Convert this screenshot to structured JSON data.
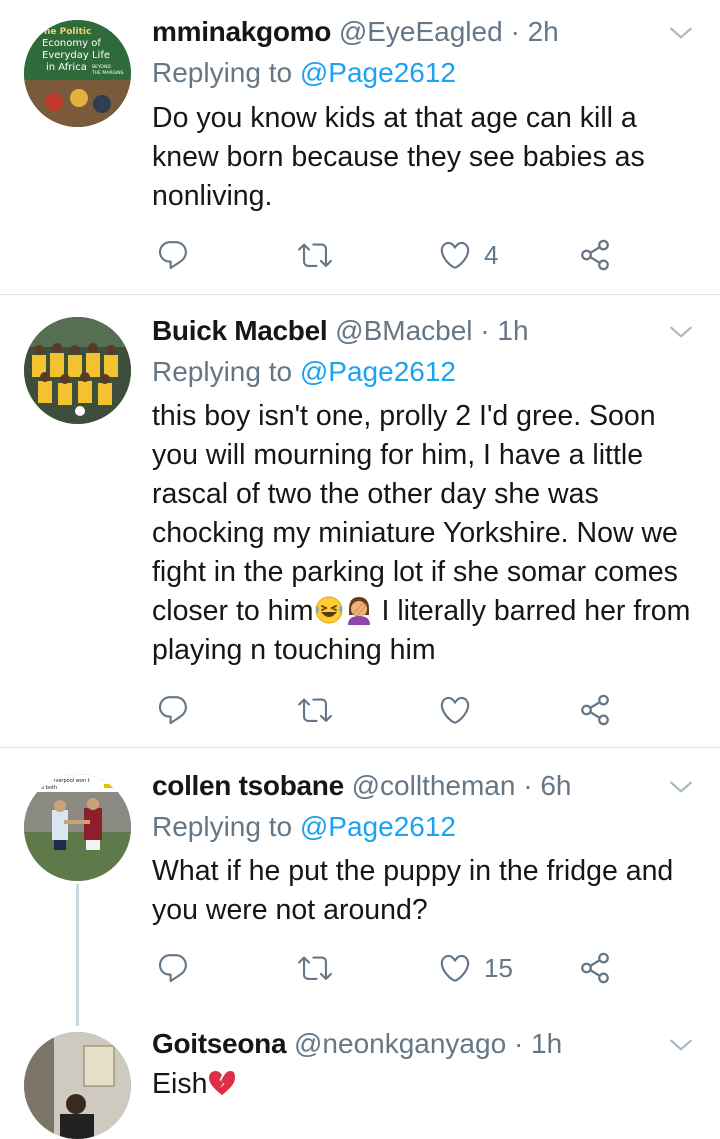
{
  "tweets": [
    {
      "name": "mminakgomo",
      "handle": "@EyeEagled",
      "time": "2h",
      "replying_prefix": "Replying to ",
      "replying_to": "@Page2612",
      "text": "Do you know kids at that age can kill a knew born because they see babies as nonliving.",
      "replies": "",
      "retweets": "",
      "likes": "4",
      "avatar_text": [
        "he Politic",
        "Economy of",
        "Everyday Life",
        "in Africa",
        "BEYOND",
        "THE MARGINS"
      ]
    },
    {
      "name": "Buick Macbel",
      "handle": "@BMacbel",
      "time": "1h",
      "replying_prefix": "Replying to ",
      "replying_to": "@Page2612",
      "text_before_emoji": "this boy isn't one, prolly 2 I'd gree. Soon you will mourning for him, I have a little rascal of two the other day she was chocking my miniature Yorkshire. Now we fight in the parking lot if she somar comes closer to him",
      "text_after_emoji": " I literally barred her from playing n touching him",
      "likes": ""
    },
    {
      "name": "collen tsobane",
      "handle": "@colltheman",
      "time": "6h",
      "replying_prefix": "Replying to ",
      "replying_to": "@Page2612",
      "text": "What if he put the puppy in the fridge and you were not around?",
      "likes": "15",
      "avatar_text": [
        "iverpool won t",
        "were both"
      ]
    },
    {
      "name": "Goitseona",
      "handle": "@neonkganyago",
      "time": "1h",
      "text": "Eish"
    }
  ],
  "separator": "·",
  "colors": {
    "text": "#14171a",
    "secondary": "#657786",
    "link": "#1da1f2",
    "divider": "#dfe4e8",
    "thread_line": "#ccd6dd"
  },
  "icons": [
    "reply-icon",
    "retweet-icon",
    "like-icon",
    "share-icon",
    "chevron-down-icon",
    "laughing-emoji",
    "woman-facepalming-emoji",
    "broken-heart-emoji"
  ]
}
